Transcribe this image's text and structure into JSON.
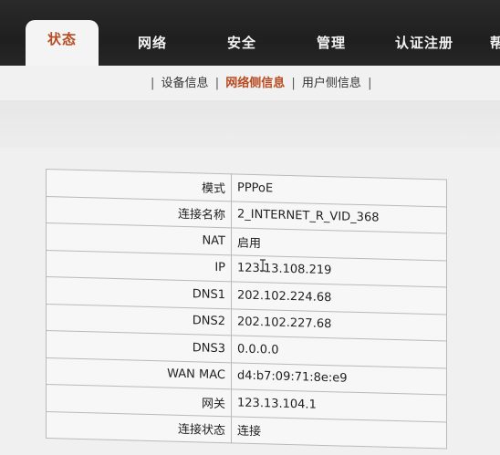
{
  "nav": {
    "tabs": [
      {
        "label": "状态",
        "active": true
      },
      {
        "label": "网络"
      },
      {
        "label": "安全"
      },
      {
        "label": "管理"
      },
      {
        "label": "认证注册"
      },
      {
        "label": "帮"
      }
    ]
  },
  "subnav": {
    "items": [
      "设备信息",
      "网络侧信息",
      "用户侧信息"
    ],
    "active_index": 1,
    "separator": "|"
  },
  "info_table": {
    "rows": [
      {
        "key": "模式",
        "value": "PPPoE"
      },
      {
        "key": "连接名称",
        "value": "2_INTERNET_R_VID_368"
      },
      {
        "key": "NAT",
        "value": "启用"
      },
      {
        "key": "IP",
        "value": "123.13.108.219"
      },
      {
        "key": "DNS1",
        "value": "202.102.224.68"
      },
      {
        "key": "DNS2",
        "value": "202.102.227.68"
      },
      {
        "key": "DNS3",
        "value": "0.0.0.0"
      },
      {
        "key": "WAN MAC",
        "value": "d4:b7:09:71:8e:e9"
      },
      {
        "key": "网关",
        "value": "123.13.104.1"
      },
      {
        "key": "连接状态",
        "value": "连接"
      }
    ]
  },
  "colors": {
    "accent": "#b84a22",
    "nav_bg": "#222222"
  }
}
